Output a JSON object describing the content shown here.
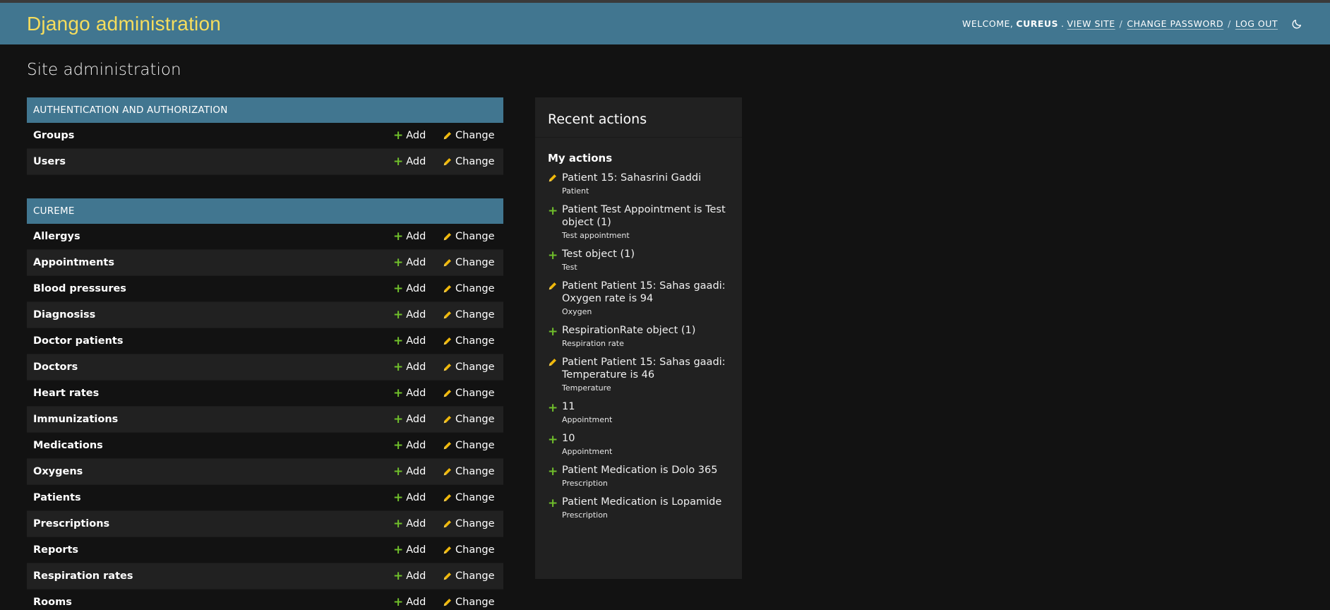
{
  "header": {
    "site_name": "Django administration",
    "welcome": "WELCOME,",
    "username": "CUREUS",
    "view_site": "VIEW SITE",
    "change_password": "CHANGE PASSWORD",
    "log_out": "LOG OUT",
    "theme_icon": "moon-icon"
  },
  "page_title": "Site administration",
  "labels": {
    "add": "Add",
    "change": "Change"
  },
  "modules": [
    {
      "caption": "AUTHENTICATION AND AUTHORIZATION",
      "models": [
        "Groups",
        "Users"
      ]
    },
    {
      "caption": "CUREME",
      "models": [
        "Allergys",
        "Appointments",
        "Blood pressures",
        "Diagnosiss",
        "Doctor patients",
        "Doctors",
        "Heart rates",
        "Immunizations",
        "Medications",
        "Oxygens",
        "Patients",
        "Prescriptions",
        "Reports",
        "Respiration rates",
        "Rooms"
      ]
    }
  ],
  "recent_actions": {
    "title": "Recent actions",
    "subtitle": "My actions",
    "items": [
      {
        "kind": "change",
        "text": "Patient 15: Sahasrini Gaddi",
        "type": "Patient"
      },
      {
        "kind": "add",
        "text": "Patient Test Appointment is Test object (1)",
        "type": "Test appointment"
      },
      {
        "kind": "add",
        "text": "Test object (1)",
        "type": "Test"
      },
      {
        "kind": "change",
        "text": "Patient Patient 15: Sahas gaadi: Oxygen rate is 94",
        "type": "Oxygen"
      },
      {
        "kind": "add",
        "text": "RespirationRate object (1)",
        "type": "Respiration rate"
      },
      {
        "kind": "change",
        "text": "Patient Patient 15: Sahas gaadi: Temperature is 46",
        "type": "Temperature"
      },
      {
        "kind": "add",
        "text": "11",
        "type": "Appointment"
      },
      {
        "kind": "add",
        "text": "10",
        "type": "Appointment"
      },
      {
        "kind": "add",
        "text": "Patient Medication is Dolo 365",
        "type": "Prescription"
      },
      {
        "kind": "add",
        "text": "Patient Medication is Lopamide",
        "type": "Prescription"
      }
    ]
  },
  "colors": {
    "header_bg": "#417690",
    "site_name": "#f5dd5d",
    "add_icon": "#70bf2b",
    "change_icon": "#efb80b"
  }
}
